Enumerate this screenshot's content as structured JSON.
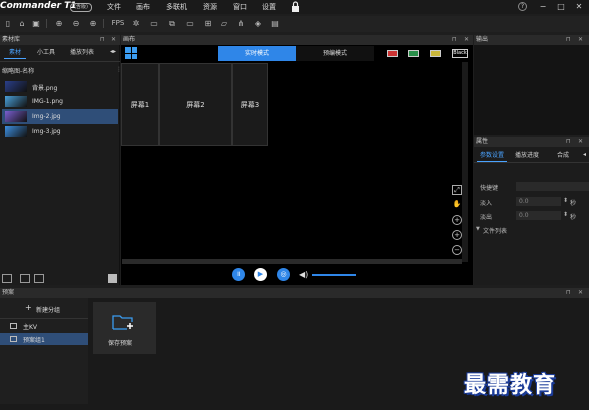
{
  "app": {
    "logo": "Commander T1",
    "version": "(含版)"
  },
  "menu": [
    "文件",
    "画布",
    "多联机",
    "资源",
    "窗口",
    "设置"
  ],
  "toolbar": {
    "fps": "FPS"
  },
  "material_panel": {
    "title": "素材库",
    "tabs": [
      "素材",
      "小工具",
      "播放列表"
    ],
    "column_header": "缩略图-名称",
    "files": [
      {
        "name": "背景.png",
        "color": "#2a3f8a",
        "selected": false
      },
      {
        "name": "IMG-1.png",
        "color": "#4aa0d8",
        "selected": false
      },
      {
        "name": "Img-2.jpg",
        "color": "#7a5fd0",
        "selected": true
      },
      {
        "name": "Img-3.jpg",
        "color": "#3d8fe0",
        "selected": false
      }
    ]
  },
  "canvas_panel": {
    "title": "画布",
    "mode_live": "实时模式",
    "mode_preview": "预编模式",
    "black_label": "Black",
    "screens": [
      "屏幕1",
      "屏幕2",
      "屏幕3"
    ]
  },
  "output_panel": {
    "title": "输出"
  },
  "props_panel": {
    "title": "属性",
    "tabs": [
      "参数设置",
      "播放进度",
      "合成"
    ],
    "shortcut_label": "快捷键",
    "fade_in_label": "淡入",
    "fade_in_value": "0.0",
    "fade_out_label": "淡出",
    "fade_out_value": "0.0",
    "unit": "秒",
    "file_list_label": "文件列表"
  },
  "bottom_panel": {
    "title": "预案",
    "new_group": "新建分组",
    "groups": [
      {
        "name": "主KV",
        "selected": false
      },
      {
        "name": "预案组1",
        "selected": true
      }
    ],
    "save_preset": "保存预案"
  },
  "watermark": "最需教育",
  "colors": {
    "accent": "#2f86e8",
    "bg": "#1e1e1e"
  }
}
